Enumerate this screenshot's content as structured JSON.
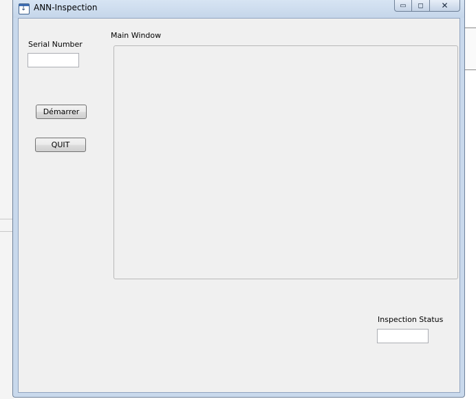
{
  "window": {
    "title": "ANN-Inspection",
    "minimize_glyph": "▭",
    "maximize_glyph": "◻",
    "close_glyph": "✕"
  },
  "form": {
    "serial_label": "Serial Number",
    "serial_value": "",
    "start_button": "Démarrer",
    "quit_button": "QUIT",
    "main_window_label": "Main Window",
    "status_label": "Inspection Status",
    "status_value": ""
  },
  "icons": {
    "app": "app-icon",
    "minimize": "minimize-icon",
    "maximize": "maximize-icon",
    "close": "close-icon"
  }
}
